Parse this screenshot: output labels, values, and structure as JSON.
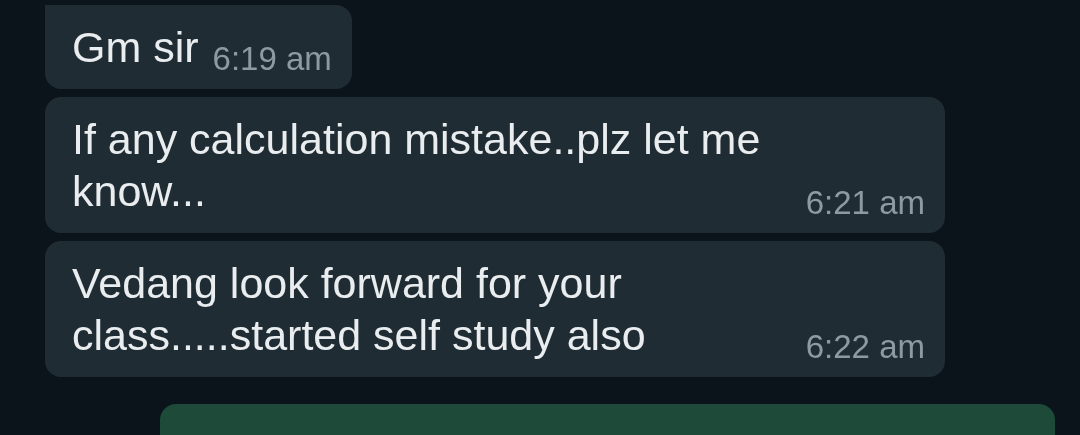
{
  "messages": [
    {
      "kind": "in",
      "tail": true,
      "text": "Gm sir",
      "time": "6:19 am"
    },
    {
      "kind": "in",
      "tail": false,
      "text": "If any calculation mistake..plz let me know...",
      "time": "6:21 am"
    },
    {
      "kind": "in",
      "tail": false,
      "text": "Vedang look forward for your class.....started self study also",
      "time": "6:22 am"
    },
    {
      "kind": "out",
      "tail": false
    }
  ]
}
